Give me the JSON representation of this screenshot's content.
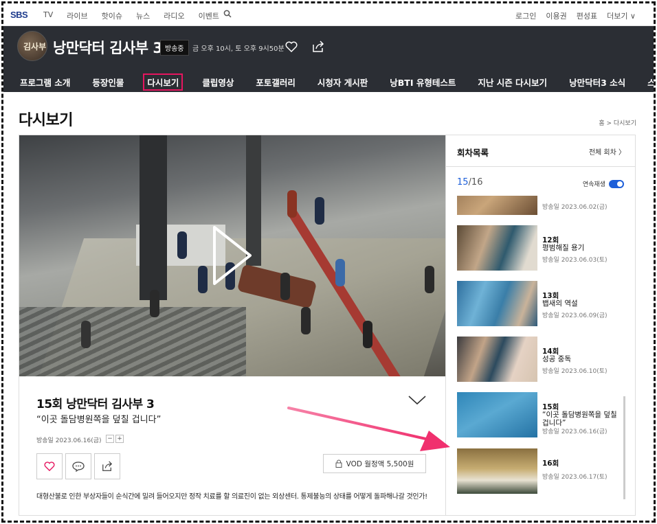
{
  "gnb": {
    "logo": "SBS",
    "menu": [
      "TV",
      "라이브",
      "핫이슈",
      "뉴스",
      "라디오",
      "이벤트"
    ],
    "right": [
      "로그인",
      "이용권",
      "편성표",
      "더보기 ∨"
    ]
  },
  "program": {
    "logo_text": "김사부",
    "title": "낭만닥터 김사부 3",
    "onair": "방송중",
    "schedule": "금 오후 10시, 토 오후 9시50분",
    "nav": [
      "프로그램 소개",
      "등장인물",
      "다시보기",
      "클립영상",
      "포토갤러리",
      "시청자 게시판",
      "낭BTI 유형테스트",
      "지난 시즌 다시보기",
      "낭만닥터3 소식",
      "스브스노리터"
    ],
    "active_nav": "다시보기"
  },
  "page": {
    "title": "다시보기",
    "breadcrumb": "홈 > 다시보기"
  },
  "episode": {
    "title": "15회 낭만닥터 김사부 3",
    "subtitle": "“이곳 돌담병원쪽을 덮칠 겁니다”",
    "date": "방송일 2023.06.16(금)",
    "font_minus": "−",
    "font_plus": "+",
    "vod": "VOD 월정액 5,500원",
    "synopsis": "대형산불로 인한 부상자들이 순식간에 밀려 들어오지만 정작 치료를 할 의료진이 없는 외상센터. 통제불능의 상태를 어떻게 돌파해나갈 것인가!"
  },
  "side": {
    "title": "회차목록",
    "all": "전체 회차 〉",
    "current": "15",
    "total": "/16",
    "autoplay": "연속재생",
    "episodes": [
      {
        "num": "",
        "name": "",
        "date": "방송일 2023.06.02(금)"
      },
      {
        "num": "12회",
        "name": "평범해질 용기",
        "date": "방송일 2023.06.03(토)"
      },
      {
        "num": "13회",
        "name": "뱁새의 역설",
        "date": "방송일 2023.06.09(금)"
      },
      {
        "num": "14회",
        "name": "성공 중독",
        "date": "방송일 2023.06.10(토)"
      },
      {
        "num": "15회",
        "name": "“이곳 돌담병원쪽을 덮칠 겁니다”",
        "date": "방송일 2023.06.16(금)"
      },
      {
        "num": "16회",
        "name": "",
        "date": "방송일 2023.06.17(토)"
      }
    ]
  },
  "colors": {
    "header_bg": "#2b2e34",
    "highlight": "#e6155f",
    "accent_blue": "#1d5fd9",
    "arrow": "#f0306e"
  }
}
